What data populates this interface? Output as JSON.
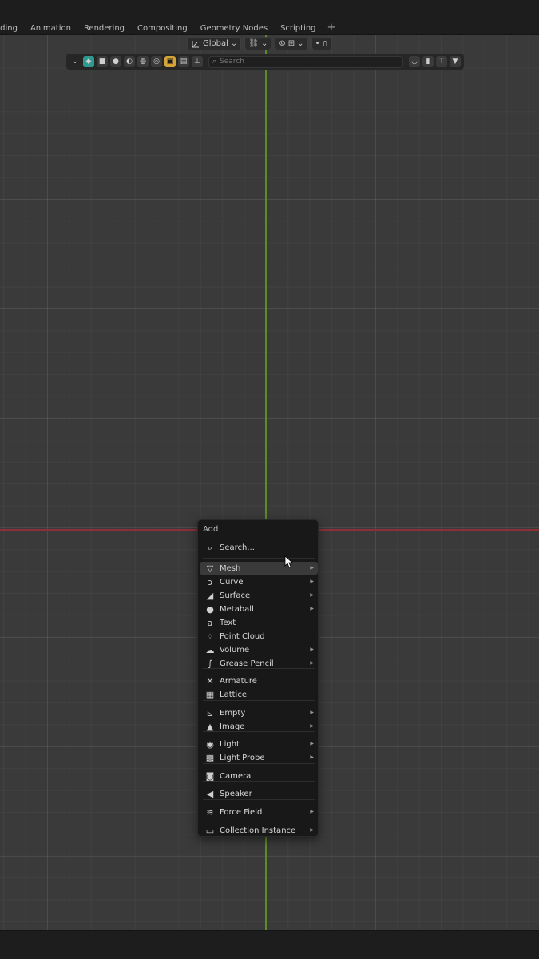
{
  "workspace_tabs": [
    "ading",
    "Animation",
    "Rendering",
    "Compositing",
    "Geometry Nodes",
    "Scripting"
  ],
  "workspace_add": "+",
  "header": {
    "orientation": "Global",
    "search_placeholder": "Search"
  },
  "add_menu": {
    "title": "Add",
    "search_label": "Search...",
    "items": [
      {
        "label": "Mesh",
        "icon": "mesh-icon",
        "submenu": true,
        "highlighted": true
      },
      {
        "label": "Curve",
        "icon": "curve-icon",
        "submenu": true
      },
      {
        "label": "Surface",
        "icon": "surface-icon",
        "submenu": true
      },
      {
        "label": "Metaball",
        "icon": "metaball-icon",
        "submenu": true
      },
      {
        "label": "Text",
        "icon": "text-icon",
        "submenu": false
      },
      {
        "label": "Point Cloud",
        "icon": "point-cloud-icon",
        "submenu": false
      },
      {
        "label": "Volume",
        "icon": "volume-icon",
        "submenu": true
      },
      {
        "label": "Grease Pencil",
        "icon": "grease-pencil-icon",
        "submenu": true
      },
      {
        "label": "Armature",
        "icon": "armature-icon",
        "submenu": false
      },
      {
        "label": "Lattice",
        "icon": "lattice-icon",
        "submenu": false
      },
      {
        "label": "Empty",
        "icon": "empty-icon",
        "submenu": true
      },
      {
        "label": "Image",
        "icon": "image-icon",
        "submenu": true
      },
      {
        "label": "Light",
        "icon": "light-icon",
        "submenu": true
      },
      {
        "label": "Light Probe",
        "icon": "light-probe-icon",
        "submenu": true
      },
      {
        "label": "Camera",
        "icon": "camera-icon",
        "submenu": false
      },
      {
        "label": "Speaker",
        "icon": "speaker-icon",
        "submenu": false
      },
      {
        "label": "Force Field",
        "icon": "force-field-icon",
        "submenu": true
      },
      {
        "label": "Collection Instance",
        "icon": "collection-instance-icon",
        "submenu": true
      }
    ]
  },
  "colors": {
    "axis_x": "#8c2f36",
    "axis_y": "#5e8a2a",
    "active_tool": "#d4a536"
  }
}
